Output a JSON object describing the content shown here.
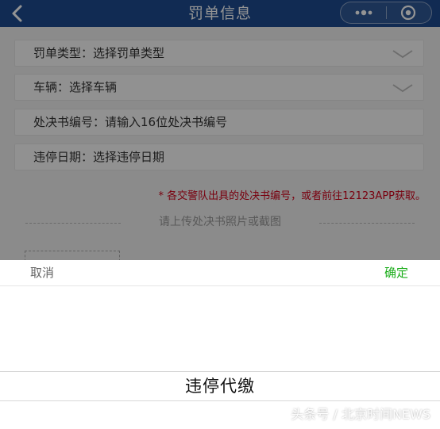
{
  "navbar": {
    "title": "罚单信息",
    "back_icon": "chevron-left-icon",
    "capsule": {
      "more_icon": "more-dots-icon",
      "close_icon": "target-icon"
    },
    "background": "#1e4b8f"
  },
  "form": {
    "fields": [
      {
        "text": "罚单类型：选择罚单类型",
        "has_dropdown": true
      },
      {
        "text": "车辆：选择车辆",
        "has_dropdown": true
      },
      {
        "text": "处决书编号：请输入16位处决书编号",
        "has_dropdown": false
      },
      {
        "text": "违停日期：选择违停日期",
        "has_dropdown": false
      }
    ],
    "notice": "* 各交警队出具的处决书编号，或者前往12123APP获取。",
    "upload_label": "请上传处决书照片或截图"
  },
  "picker": {
    "cancel_label": "取消",
    "confirm_label": "确定",
    "options": [
      "违停代缴"
    ],
    "confirm_color": "#1aad19"
  },
  "watermark": "头条号 / 北京时间NEWS"
}
